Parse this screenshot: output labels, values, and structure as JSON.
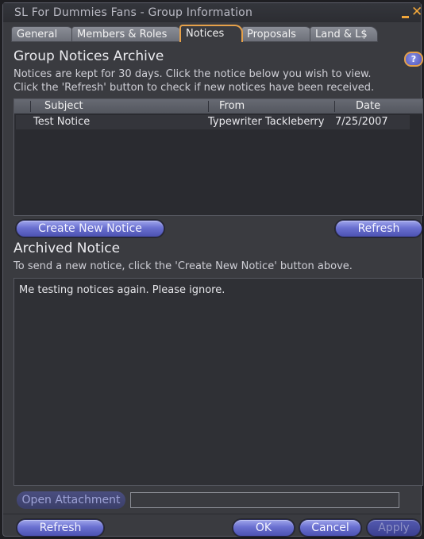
{
  "window": {
    "title": "SL For Dummies Fans - Group Information"
  },
  "tabs": [
    {
      "label": "General",
      "active": false
    },
    {
      "label": "Members & Roles",
      "active": false
    },
    {
      "label": "Notices",
      "active": true
    },
    {
      "label": "Proposals",
      "active": false
    },
    {
      "label": "Land & L$",
      "active": false
    }
  ],
  "archive": {
    "title": "Group Notices Archive",
    "desc_line1": "Notices are kept for 30 days. Click the notice below you wish to view.",
    "desc_line2": "Click the 'Refresh' button to check if new notices have been received.",
    "help_label": "?",
    "columns": {
      "subject": "Subject",
      "from": "From",
      "date": "Date"
    },
    "rows": [
      {
        "subject": "Test Notice",
        "from": "Typewriter Tackleberry",
        "date": "7/25/2007"
      }
    ],
    "create_button": "Create New Notice",
    "refresh_button": "Refresh"
  },
  "archived_notice": {
    "title": "Archived Notice",
    "desc": "To send a new notice, click the 'Create New Notice' button above.",
    "body": "Me testing notices again. Please ignore.",
    "open_attachment_label": "Open Attachment",
    "attachment_value": ""
  },
  "footer": {
    "refresh_button": "Refresh",
    "ok_button": "OK",
    "cancel_button": "Cancel",
    "apply_button": "Apply"
  },
  "colors": {
    "accent": "#e6a14a",
    "button": "#6a70d0",
    "panel": "#3a3b40"
  }
}
